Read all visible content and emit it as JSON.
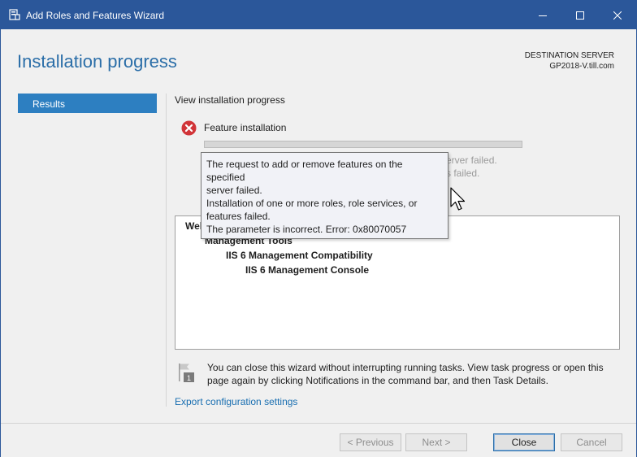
{
  "window": {
    "title": "Add Roles and Features Wizard"
  },
  "header": {
    "page_title": "Installation progress",
    "destination_label": "DESTINATION SERVER",
    "destination_server": "GP2018-V.till.com"
  },
  "sidebar": {
    "items": [
      {
        "label": "Results",
        "selected": true
      }
    ]
  },
  "main": {
    "section_label": "View installation progress",
    "feature_status_label": "Feature installation",
    "progress_fraction": 1.0,
    "obscured_text_1": "erver failed.",
    "obscured_text_2": "s failed.",
    "results": [
      "Wel",
      "Management Tools",
      "IIS 6 Management Compatibility",
      "IIS 6 Management Console"
    ],
    "tooltip": {
      "line_1": "The request to add or remove features on the specified",
      "line_2": "server failed.",
      "line_3": "Installation of one or more roles, role services, or",
      "line_4": "features failed.",
      "line_5": "The parameter is incorrect. Error: 0x80070057"
    },
    "note": "You can close this wizard without interrupting running tasks. View task progress or open this page again by clicking Notifications in the command bar, and then Task Details.",
    "export_link": "Export configuration settings"
  },
  "footer": {
    "previous_label": "< Previous",
    "next_label": "Next >",
    "close_label": "Close",
    "cancel_label": "Cancel"
  },
  "colors": {
    "titlebar": "#2b579a",
    "accent": "#2d7fc1",
    "error": "#d13438"
  }
}
